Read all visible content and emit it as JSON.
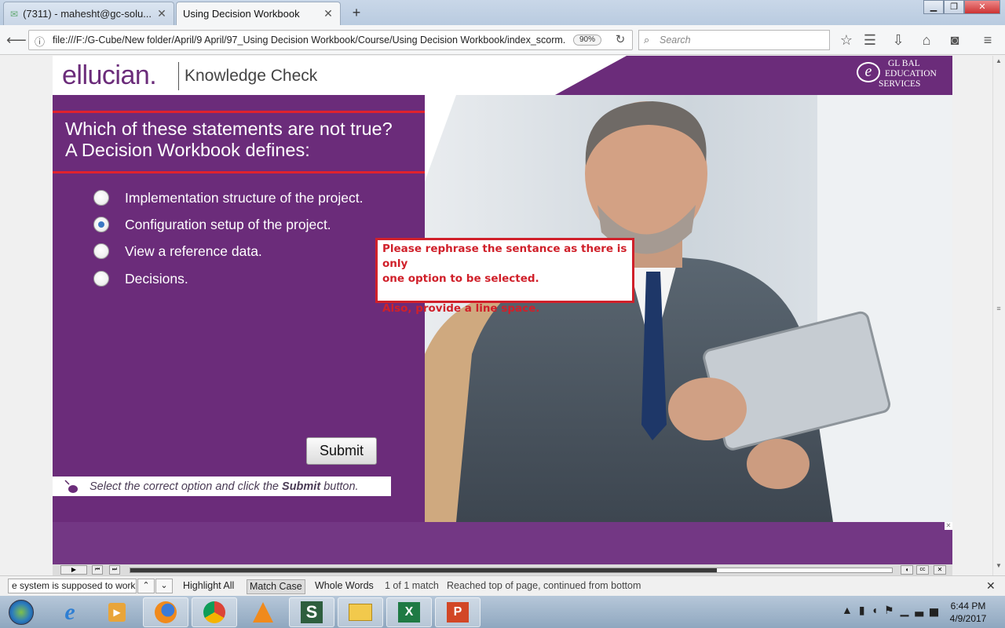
{
  "browser": {
    "tabs": [
      {
        "title": "(7311) - mahesht@gc-solu...",
        "active": false
      },
      {
        "title": "Using Decision Workbook",
        "active": true
      }
    ],
    "url": "file:///F:/G-Cube/New folder/April/9 April/97_Using Decision Workbook/Course/Using Decision Workbook/index_scorm.",
    "zoom": "90%",
    "search_placeholder": "Search"
  },
  "course": {
    "logo": "ellucian.",
    "section_title": "Knowledge Check",
    "ges_lines": [
      "GL BAL",
      "EDUCATION",
      "SERVICES"
    ],
    "ges_letter": "e",
    "question_line1": "Which of these statements are not true?",
    "question_line2": "A Decision Workbook defines:",
    "options": [
      {
        "label": "Implementation structure of the project.",
        "selected": false
      },
      {
        "label": "Configuration setup of the project.",
        "selected": true
      },
      {
        "label": "View a reference data.",
        "selected": false
      },
      {
        "label": "Decisions.",
        "selected": false
      }
    ],
    "submit_label": "Submit",
    "hint_pre": "Select the correct option and click the ",
    "hint_bold": "Submit",
    "hint_post": " button.",
    "annotation_line1": " Please rephrase the sentance as there is only",
    "annotation_line2": "one option to be selected.",
    "annotation_line3": "Also, provide a line space.",
    "progress_fraction": 0.77
  },
  "findbar": {
    "query": "e system is supposed to work",
    "highlight_all": "Highlight All",
    "match_case": "Match Case",
    "whole_words": "Whole Words",
    "match_count": "1 of 1 match",
    "status": "Reached top of page, continued from bottom"
  },
  "taskbar": {
    "time": "6:44 PM",
    "date": "4/9/2017"
  },
  "colors": {
    "brand_purple": "#6b2c7a",
    "annotation_red": "#d0202a"
  }
}
